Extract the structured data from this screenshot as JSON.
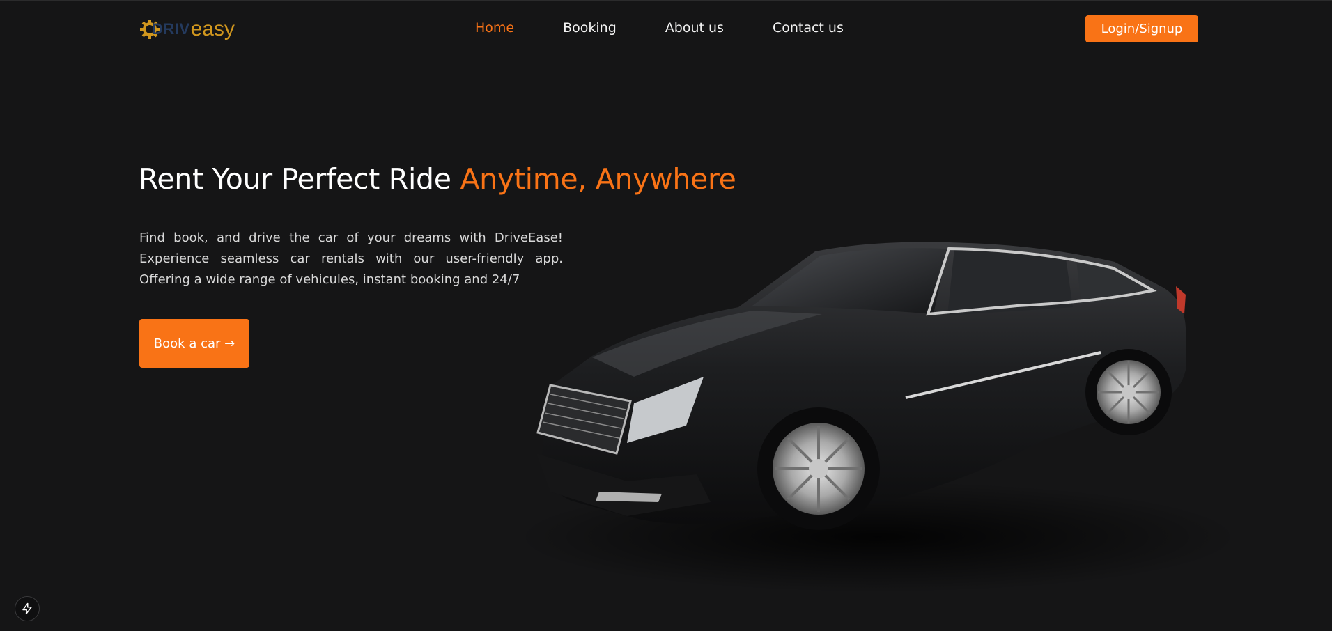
{
  "logo": {
    "brand_part1": "DRIV",
    "brand_part2": "easy",
    "icon": "gear-icon",
    "gear_color": "#d1971e",
    "driv_color": "#243a5e"
  },
  "nav": {
    "links": [
      {
        "label": "Home",
        "active": true
      },
      {
        "label": "Booking",
        "active": false
      },
      {
        "label": "About us",
        "active": false
      },
      {
        "label": "Contact us",
        "active": false
      }
    ],
    "login_label": "Login/Signup"
  },
  "hero": {
    "title_main": "Rent Your Perfect Ride ",
    "title_accent": "Anytime, Anywhere",
    "description": "Find book, and drive the car of your dreams with DriveEase! Experience seamless car rentals with our user-friendly app. Offering a wide range of vehicules, instant booking and 24/7",
    "cta_label": "Book a car →"
  },
  "hero_image": {
    "icon": "car-image"
  },
  "devtools": {
    "icon": "lightning-icon"
  },
  "colors": {
    "accent": "#f97316",
    "background": "#151516",
    "text": "#ffffff",
    "muted_text": "#d8d8d8"
  }
}
